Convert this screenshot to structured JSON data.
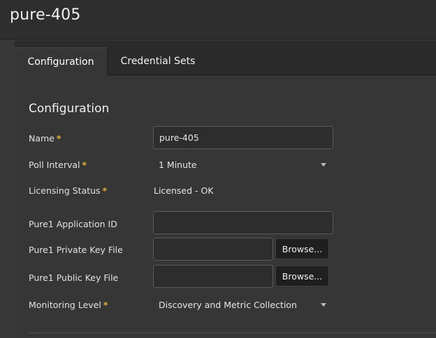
{
  "header": {
    "title": "pure-405"
  },
  "tabs": [
    {
      "label": "Configuration",
      "active": true
    },
    {
      "label": "Credential Sets",
      "active": false
    }
  ],
  "section": {
    "title": "Configuration"
  },
  "form": {
    "name": {
      "label": "Name",
      "required": "*",
      "value": "pure-405"
    },
    "poll_interval": {
      "label": "Poll Interval",
      "required": "*",
      "value": "1 Minute"
    },
    "licensing_status": {
      "label": "Licensing Status",
      "required": "*",
      "value": "Licensed - OK"
    },
    "app_id": {
      "label": "Pure1 Application ID",
      "value": ""
    },
    "private_key": {
      "label": "Pure1 Private Key File",
      "value": "",
      "browse_label": "Browse..."
    },
    "public_key": {
      "label": "Pure1 Public Key File",
      "value": "",
      "browse_label": "Browse..."
    },
    "monitoring_level": {
      "label": "Monitoring Level",
      "required": "*",
      "value": "Discovery and Metric Collection"
    }
  },
  "colors": {
    "required_star": "#e6b22e",
    "background": "#383838"
  }
}
